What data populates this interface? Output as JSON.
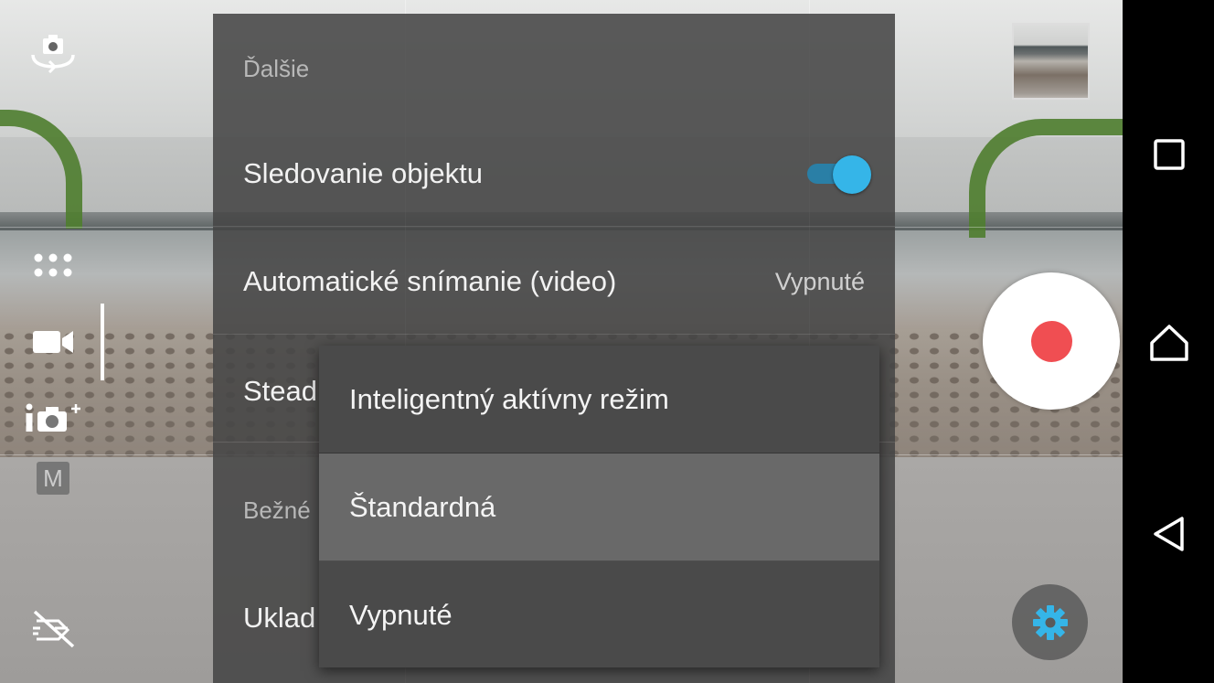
{
  "settings_panel": {
    "section_more": "Ďalšie",
    "rows": [
      {
        "label": "Sledovanie objektu",
        "toggle_on": true
      },
      {
        "label": "Automatické snímanie (video)",
        "value": "Vypnuté"
      },
      {
        "label": "Stead"
      }
    ],
    "section_common": "Bežné",
    "rows_common": [
      {
        "label": "Uklad"
      }
    ]
  },
  "dropdown": {
    "options": [
      "Inteligentný aktívny režim",
      "Štandardná",
      "Vypnuté"
    ],
    "selected_index": 1
  },
  "left_toolbar": {
    "icons": [
      "switch-camera-icon",
      "apps-grid-icon",
      "video-camera-icon",
      "photo-camera-plus-icon",
      "manual-mode-icon",
      "flash-off-icon"
    ],
    "manual_label": "M",
    "active_mode": "video-camera-icon"
  },
  "right_controls": {
    "record_color": "#f04e52",
    "settings_icon_color": "#35b5e8"
  },
  "navbar": {
    "icons": [
      "recents-icon",
      "home-icon",
      "back-icon"
    ]
  },
  "colors": {
    "toggle_accent": "#35b5e8",
    "panel_bg": "#464646",
    "menu_selected": "#696969"
  }
}
